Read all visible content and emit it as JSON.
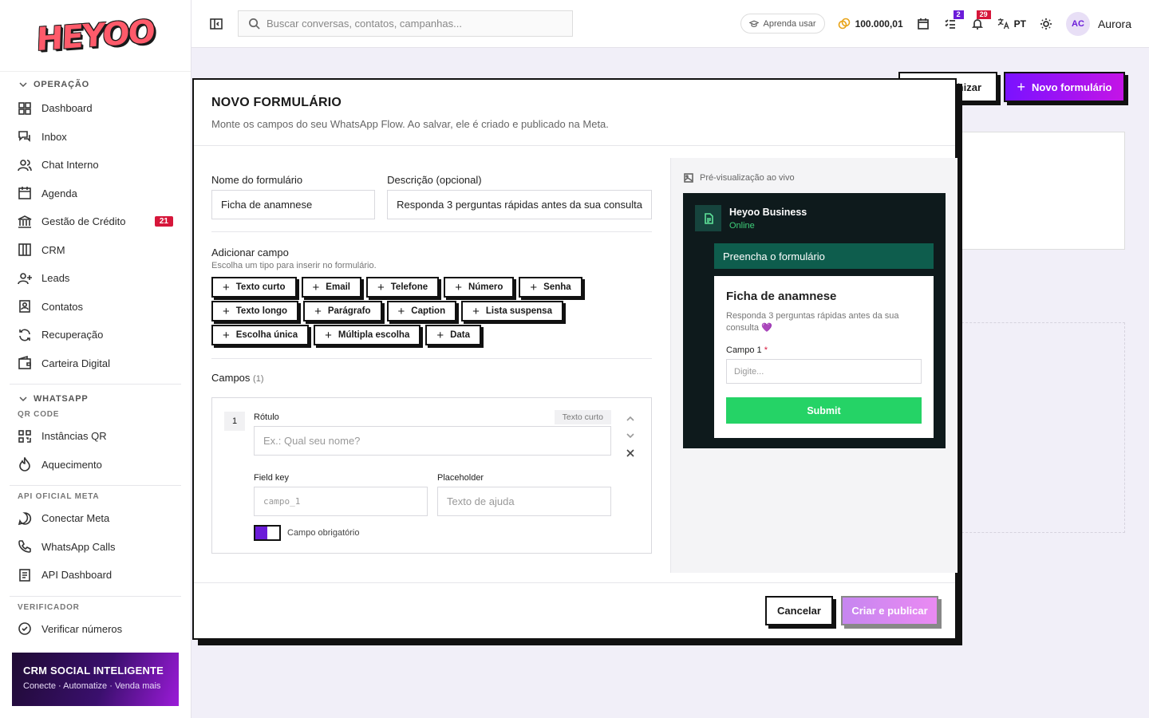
{
  "brand": {
    "logo": "HEYOO"
  },
  "sidebar": {
    "sections": {
      "operacao": "OPERAÇÃO",
      "whatsapp": "WHATSAPP",
      "qr_code": "QR CODE",
      "api_oficial": "API OFICIAL META",
      "verificador": "VERIFICADOR"
    },
    "items": {
      "dashboard": "Dashboard",
      "inbox": "Inbox",
      "chat_interno": "Chat Interno",
      "agenda": "Agenda",
      "gestao_credito": "Gestão de Crédito",
      "gestao_credito_badge": "21",
      "crm": "CRM",
      "leads": "Leads",
      "contatos": "Contatos",
      "recuperacao": "Recuperação",
      "carteira": "Carteira Digital",
      "instancias_qr": "Instâncias QR",
      "aquecimento": "Aquecimento",
      "conectar_meta": "Conectar Meta",
      "whatsapp_calls": "WhatsApp Calls",
      "api_dashboard": "API Dashboard",
      "verificar_numeros": "Verificar números"
    },
    "promo": {
      "title": "CRM SOCIAL INTELIGENTE",
      "subtitle": "Conecte · Automatize · Venda mais"
    }
  },
  "topbar": {
    "search_placeholder": "Buscar conversas, contatos, campanhas...",
    "learn": "Aprenda usar",
    "coins": "100.000,01",
    "tasks_badge": "2",
    "notif_badge": "29",
    "lang": "PT",
    "avatar_initials": "AC",
    "user_name": "Aurora"
  },
  "background": {
    "btn_secondary": "hizar",
    "btn_primary": "Novo formulário"
  },
  "modal": {
    "title": "NOVO FORMULÁRIO",
    "subtitle": "Monte os campos do seu WhatsApp Flow. Ao salvar, ele é criado e publicado na Meta.",
    "name_label": "Nome do formulário",
    "name_value": "Ficha de anamnese",
    "desc_label": "Descrição (opcional)",
    "desc_value": "Responda 3 perguntas rápidas antes da sua consulta",
    "add_title": "Adicionar campo",
    "add_sub": "Escolha um tipo para inserir no formulário.",
    "chips": [
      "Texto curto",
      "Email",
      "Telefone",
      "Número",
      "Senha",
      "Texto longo",
      "Parágrafo",
      "Caption",
      "Lista suspensa",
      "Escolha única",
      "Múltipla escolha",
      "Data"
    ],
    "campos_label": "Campos",
    "campos_count": "(1)",
    "field": {
      "index": "1",
      "rotulo_label": "Rótulo",
      "type_tag": "Texto curto",
      "rotulo_placeholder": "Ex.: Qual seu nome?",
      "key_label": "Field key",
      "key_placeholder": "campo_1",
      "placeholder_label": "Placeholder",
      "placeholder_placeholder": "Texto de ajuda",
      "required_label": "Campo obrigatório"
    },
    "preview": {
      "label": "Pré-visualização ao vivo",
      "business": "Heyoo Business",
      "status": "Online",
      "bar": "Preencha o formulário",
      "form_title": "Ficha de anamnese",
      "form_desc": "Responda 3 perguntas rápidas antes da sua consulta 💜",
      "field_label": "Campo 1",
      "req_mark": "*",
      "field_placeholder": "Digite...",
      "submit": "Submit"
    },
    "cancel": "Cancelar",
    "publish": "Criar e publicar"
  },
  "colors": {
    "accent": "#6b1cd9",
    "danger": "#d6163a",
    "whatsapp": "#25d366",
    "preview_bg": "#0e1a1c"
  }
}
